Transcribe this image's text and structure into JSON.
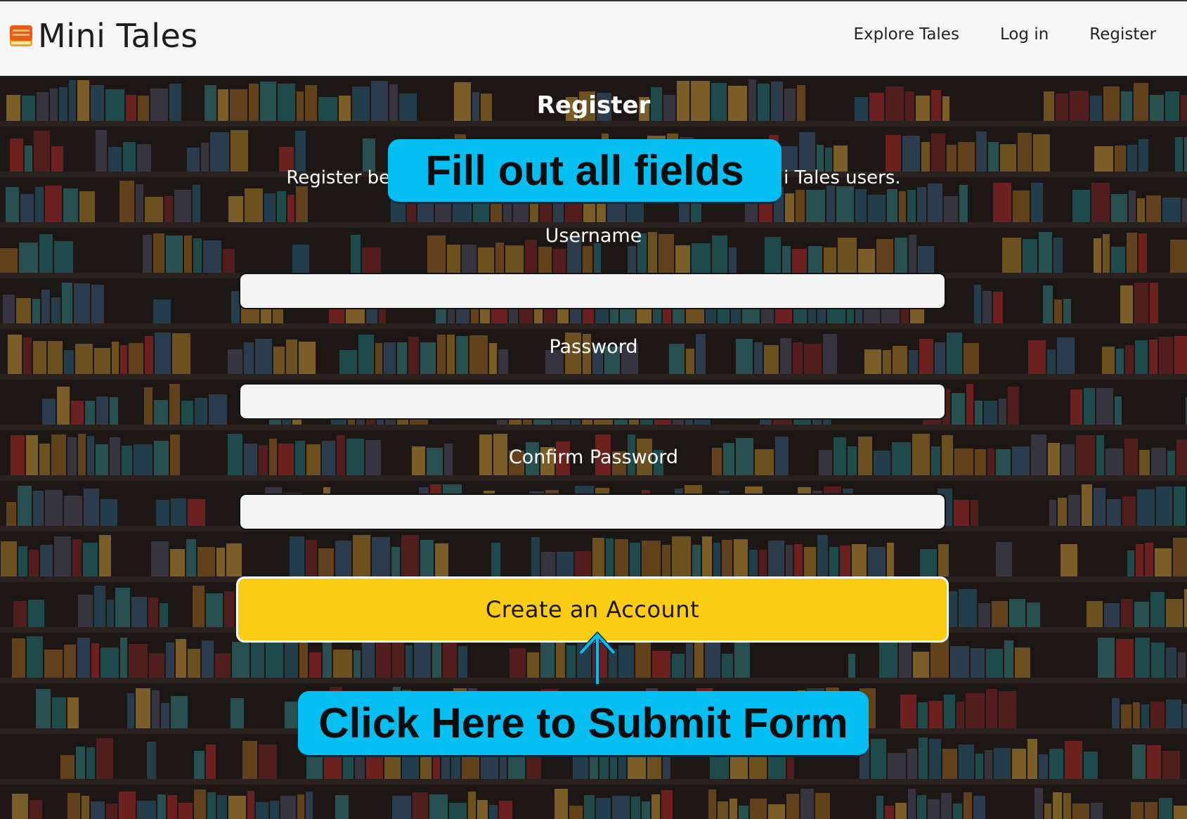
{
  "app": {
    "name": "Mini Tales",
    "logo_icon": "book-icon"
  },
  "nav": {
    "items": [
      {
        "label": "Explore Tales"
      },
      {
        "label": "Log in"
      },
      {
        "label": "Register"
      }
    ]
  },
  "form": {
    "title": "Register",
    "description_left": "Register be",
    "description_right": "i Tales users.",
    "fields": [
      {
        "label": "Username",
        "value": ""
      },
      {
        "label": "Password",
        "value": ""
      },
      {
        "label": "Confirm Password",
        "value": ""
      }
    ],
    "submit_label": "Create an Account"
  },
  "annotations": {
    "fill_fields": "Fill out all fields",
    "submit_hint": "Click Here to Submit Form",
    "arrow_icon": "up-arrow-icon"
  },
  "colors": {
    "header_bg": "#f6f6f6",
    "submit_button": "#facd14",
    "callout": "#06bff2",
    "shelf_dark": "#1c1715"
  }
}
